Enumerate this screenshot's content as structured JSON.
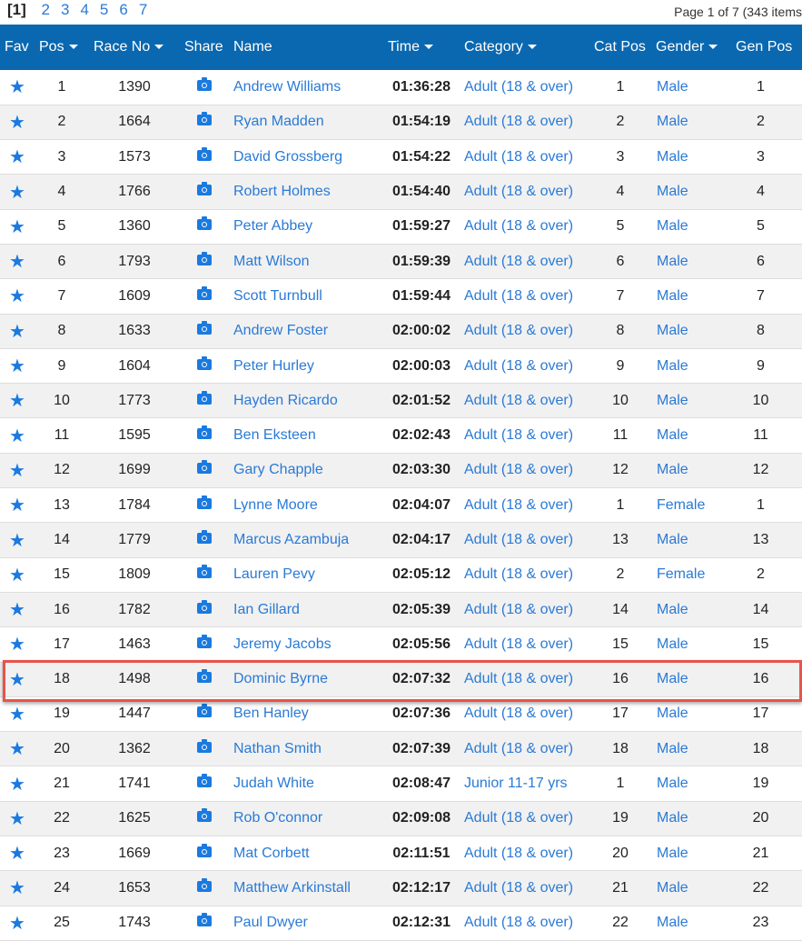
{
  "pager": {
    "current": "[1]",
    "pages": [
      "2",
      "3",
      "4",
      "5",
      "6",
      "7"
    ],
    "info": "Page 1 of 7 (343 items"
  },
  "headers": {
    "fav": "Fav",
    "pos": "Pos",
    "race_no": "Race No",
    "share": "Share",
    "name": "Name",
    "time": "Time",
    "category": "Category",
    "cat_pos": "Cat Pos",
    "gender": "Gender",
    "gen_pos": "Gen Pos"
  },
  "highlighted_row": 18,
  "rows": [
    {
      "pos": "1",
      "race_no": "1390",
      "name": "Andrew Williams",
      "time": "01:36:28",
      "category": "Adult (18 & over)",
      "cat_pos": "1",
      "gender": "Male",
      "gen_pos": "1"
    },
    {
      "pos": "2",
      "race_no": "1664",
      "name": "Ryan Madden",
      "time": "01:54:19",
      "category": "Adult (18 & over)",
      "cat_pos": "2",
      "gender": "Male",
      "gen_pos": "2"
    },
    {
      "pos": "3",
      "race_no": "1573",
      "name": "David Grossberg",
      "time": "01:54:22",
      "category": "Adult (18 & over)",
      "cat_pos": "3",
      "gender": "Male",
      "gen_pos": "3"
    },
    {
      "pos": "4",
      "race_no": "1766",
      "name": "Robert Holmes",
      "time": "01:54:40",
      "category": "Adult (18 & over)",
      "cat_pos": "4",
      "gender": "Male",
      "gen_pos": "4"
    },
    {
      "pos": "5",
      "race_no": "1360",
      "name": "Peter Abbey",
      "time": "01:59:27",
      "category": "Adult (18 & over)",
      "cat_pos": "5",
      "gender": "Male",
      "gen_pos": "5"
    },
    {
      "pos": "6",
      "race_no": "1793",
      "name": "Matt Wilson",
      "time": "01:59:39",
      "category": "Adult (18 & over)",
      "cat_pos": "6",
      "gender": "Male",
      "gen_pos": "6"
    },
    {
      "pos": "7",
      "race_no": "1609",
      "name": "Scott Turnbull",
      "time": "01:59:44",
      "category": "Adult (18 & over)",
      "cat_pos": "7",
      "gender": "Male",
      "gen_pos": "7"
    },
    {
      "pos": "8",
      "race_no": "1633",
      "name": "Andrew Foster",
      "time": "02:00:02",
      "category": "Adult (18 & over)",
      "cat_pos": "8",
      "gender": "Male",
      "gen_pos": "8"
    },
    {
      "pos": "9",
      "race_no": "1604",
      "name": "Peter Hurley",
      "time": "02:00:03",
      "category": "Adult (18 & over)",
      "cat_pos": "9",
      "gender": "Male",
      "gen_pos": "9"
    },
    {
      "pos": "10",
      "race_no": "1773",
      "name": "Hayden Ricardo",
      "time": "02:01:52",
      "category": "Adult (18 & over)",
      "cat_pos": "10",
      "gender": "Male",
      "gen_pos": "10"
    },
    {
      "pos": "11",
      "race_no": "1595",
      "name": "Ben Eksteen",
      "time": "02:02:43",
      "category": "Adult (18 & over)",
      "cat_pos": "11",
      "gender": "Male",
      "gen_pos": "11"
    },
    {
      "pos": "12",
      "race_no": "1699",
      "name": "Gary Chapple",
      "time": "02:03:30",
      "category": "Adult (18 & over)",
      "cat_pos": "12",
      "gender": "Male",
      "gen_pos": "12"
    },
    {
      "pos": "13",
      "race_no": "1784",
      "name": "Lynne Moore",
      "time": "02:04:07",
      "category": "Adult (18 & over)",
      "cat_pos": "1",
      "gender": "Female",
      "gen_pos": "1"
    },
    {
      "pos": "14",
      "race_no": "1779",
      "name": "Marcus Azambuja",
      "time": "02:04:17",
      "category": "Adult (18 & over)",
      "cat_pos": "13",
      "gender": "Male",
      "gen_pos": "13"
    },
    {
      "pos": "15",
      "race_no": "1809",
      "name": "Lauren Pevy",
      "time": "02:05:12",
      "category": "Adult (18 & over)",
      "cat_pos": "2",
      "gender": "Female",
      "gen_pos": "2"
    },
    {
      "pos": "16",
      "race_no": "1782",
      "name": "Ian Gillard",
      "time": "02:05:39",
      "category": "Adult (18 & over)",
      "cat_pos": "14",
      "gender": "Male",
      "gen_pos": "14"
    },
    {
      "pos": "17",
      "race_no": "1463",
      "name": "Jeremy Jacobs",
      "time": "02:05:56",
      "category": "Adult (18 & over)",
      "cat_pos": "15",
      "gender": "Male",
      "gen_pos": "15"
    },
    {
      "pos": "18",
      "race_no": "1498",
      "name": "Dominic Byrne",
      "time": "02:07:32",
      "category": "Adult (18 & over)",
      "cat_pos": "16",
      "gender": "Male",
      "gen_pos": "16"
    },
    {
      "pos": "19",
      "race_no": "1447",
      "name": "Ben Hanley",
      "time": "02:07:36",
      "category": "Adult (18 & over)",
      "cat_pos": "17",
      "gender": "Male",
      "gen_pos": "17"
    },
    {
      "pos": "20",
      "race_no": "1362",
      "name": "Nathan Smith",
      "time": "02:07:39",
      "category": "Adult (18 & over)",
      "cat_pos": "18",
      "gender": "Male",
      "gen_pos": "18"
    },
    {
      "pos": "21",
      "race_no": "1741",
      "name": "Judah White",
      "time": "02:08:47",
      "category": "Junior 11-17 yrs",
      "cat_pos": "1",
      "gender": "Male",
      "gen_pos": "19"
    },
    {
      "pos": "22",
      "race_no": "1625",
      "name": "Rob O'connor",
      "time": "02:09:08",
      "category": "Adult (18 & over)",
      "cat_pos": "19",
      "gender": "Male",
      "gen_pos": "20"
    },
    {
      "pos": "23",
      "race_no": "1669",
      "name": "Mat Corbett",
      "time": "02:11:51",
      "category": "Adult (18 & over)",
      "cat_pos": "20",
      "gender": "Male",
      "gen_pos": "21"
    },
    {
      "pos": "24",
      "race_no": "1653",
      "name": "Matthew Arkinstall",
      "time": "02:12:17",
      "category": "Adult (18 & over)",
      "cat_pos": "21",
      "gender": "Male",
      "gen_pos": "22"
    },
    {
      "pos": "25",
      "race_no": "1743",
      "name": "Paul Dwyer",
      "time": "02:12:31",
      "category": "Adult (18 & over)",
      "cat_pos": "22",
      "gender": "Male",
      "gen_pos": "23"
    }
  ]
}
